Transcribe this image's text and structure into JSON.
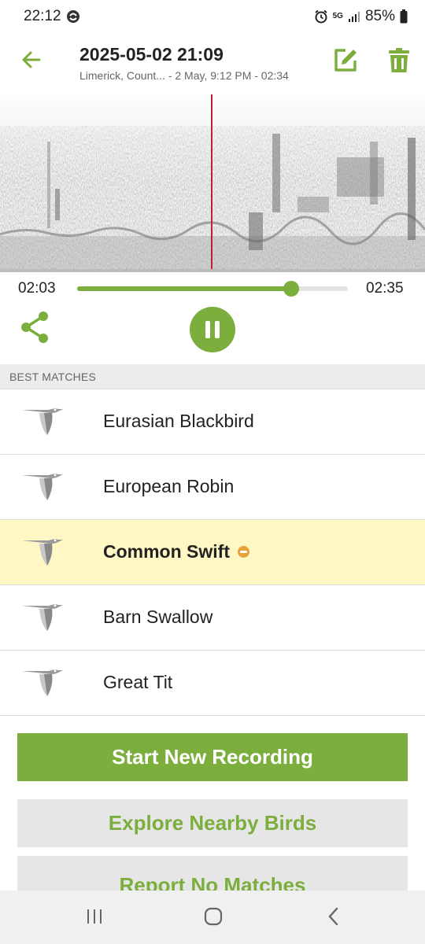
{
  "status_bar": {
    "time": "22:12",
    "network": "5G",
    "battery": "85%"
  },
  "header": {
    "title": "2025-05-02 21:09",
    "subtitle": "Limerick, Count... - 2 May, 9:12 PM - 02:34"
  },
  "player": {
    "current_time": "02:03",
    "end_time": "02:35",
    "progress": 0.79
  },
  "matches": {
    "section_label": "BEST MATCHES",
    "items": [
      {
        "name": "Eurasian Blackbird",
        "highlighted": false
      },
      {
        "name": "European Robin",
        "highlighted": false
      },
      {
        "name": "Common Swift",
        "highlighted": true
      },
      {
        "name": "Barn Swallow",
        "highlighted": false
      },
      {
        "name": "Great Tit",
        "highlighted": false
      }
    ]
  },
  "actions": {
    "start_recording": "Start New Recording",
    "explore_nearby": "Explore Nearby Birds",
    "report_no_matches": "Report No Matches"
  },
  "colors": {
    "accent": "#7cae3e",
    "highlight": "#fff8c4",
    "playhead": "#c0202a",
    "status_dot": "#e8a23a"
  },
  "icons": [
    "alarm-icon",
    "signal-icon",
    "battery-icon",
    "back-arrow-icon",
    "edit-icon",
    "trash-icon",
    "share-icon",
    "pause-icon",
    "bird-icon",
    "recents-icon",
    "home-icon",
    "nav-back-icon"
  ]
}
